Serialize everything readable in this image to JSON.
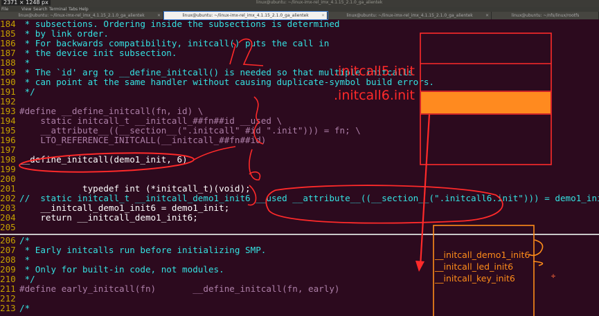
{
  "window": {
    "dimensions_label": "2371 × 1248 px",
    "title": "linux@ubuntu: ~/linux-imx-rel_imx_4.1.15_2.1.0_ga_alientek"
  },
  "menu": [
    "File",
    "View",
    "Search",
    "Terminal",
    "Tabs",
    "Help"
  ],
  "tabs": [
    {
      "label": "linux@ubuntu: ~/linux-imx-rel_imx_4.1.15_2.1.0_ga_alientek",
      "active": false
    },
    {
      "label": "linux@ubuntu: ~/linux-imx-rel_imx_4.1.15_2.1.0_ga_alientek",
      "active": true
    },
    {
      "label": "linux@ubuntu: ~/linux-imx-rel_imx_4.1.15_2.1.0_ga_alientek",
      "active": false
    },
    {
      "label": "linux@ubuntu: ~/nfs/linux/rootfs",
      "active": false
    }
  ],
  "editor_top": {
    "lines": [
      {
        "n": "184",
        "text": " * subsections. Ordering inside the subsections is determined",
        "kind": "comment"
      },
      {
        "n": "185",
        "text": " * by link order.",
        "kind": "comment"
      },
      {
        "n": "186",
        "text": " * For backwards compatibility, initcall() puts the call in",
        "kind": "comment"
      },
      {
        "n": "187",
        "text": " * the device init subsection.",
        "kind": "comment"
      },
      {
        "n": "188",
        "text": " *",
        "kind": "comment"
      },
      {
        "n": "189",
        "text": " * The `id' arg to __define_initcall() is needed so that multiple initcalls",
        "kind": "comment"
      },
      {
        "n": "190",
        "text": " * can point at the same handler without causing duplicate-symbol build errors.",
        "kind": "comment"
      },
      {
        "n": "191",
        "text": " */",
        "kind": "comment"
      },
      {
        "n": "192",
        "text": "",
        "kind": "plain"
      },
      {
        "n": "193",
        "text": "#define __define_initcall(fn, id) \\",
        "kind": "pre"
      },
      {
        "n": "194",
        "text": "    static initcall_t __initcall_##fn##id __used \\",
        "kind": "pre"
      },
      {
        "n": "195",
        "text": "    __attribute__((__section__(\".initcall\" #id \".init\"))) = fn; \\",
        "kind": "pre"
      },
      {
        "n": "196",
        "text": "    LTO_REFERENCE_INITCALL(__initcall_##fn##id)",
        "kind": "pre"
      },
      {
        "n": "197",
        "text": "",
        "kind": "plain"
      },
      {
        "n": "198",
        "text": "__define_initcall(demo1_init, 6)",
        "kind": "plain"
      },
      {
        "n": "199",
        "text": "",
        "kind": "plain"
      },
      {
        "n": "200",
        "text": "",
        "kind": "plain"
      },
      {
        "n": "201",
        "text": "            typedef int (*initcall_t)(void);",
        "kind": "plain"
      },
      {
        "n": "202",
        "text": "//  static initcall_t __initcall_demo1_init6 __used __attribute__((__section__(\".initcall6.init\"))) = demo1_init;",
        "kind": "comment"
      },
      {
        "n": "203",
        "text": "    __initcall_demo1_init6 = demo1_init;",
        "kind": "plain"
      },
      {
        "n": "204",
        "text": "    return __initcall_demo1_init6;",
        "kind": "plain"
      },
      {
        "n": "205",
        "text": "",
        "kind": "plain"
      }
    ]
  },
  "editor_bottom": {
    "lines": [
      {
        "n": "206",
        "text": "/*",
        "kind": "comment"
      },
      {
        "n": "207",
        "text": " * Early initcalls run before initializing SMP.",
        "kind": "comment"
      },
      {
        "n": "208",
        "text": " *",
        "kind": "comment"
      },
      {
        "n": "209",
        "text": " * Only for built-in code, not modules.",
        "kind": "comment"
      },
      {
        "n": "210",
        "text": " */",
        "kind": "comment"
      },
      {
        "n": "211",
        "text": "#define early_initcall(fn)       __define_initcall(fn, early)",
        "kind": "pre"
      },
      {
        "n": "212",
        "text": "",
        "kind": "plain"
      },
      {
        "n": "213",
        "text": "/*",
        "kind": "comment"
      }
    ]
  },
  "annotations": {
    "section_labels": [
      ".initcall5.init",
      ".initcall6.init"
    ],
    "section_entries": [
      "__initcall_demo1_init6",
      "__initcall_led_init6",
      "__initcall_key_init6"
    ],
    "colors": {
      "red_ink": "#ff2a2a",
      "orange_ink": "#ff8c1a",
      "highlight_fill": "#ff8a1f"
    }
  }
}
